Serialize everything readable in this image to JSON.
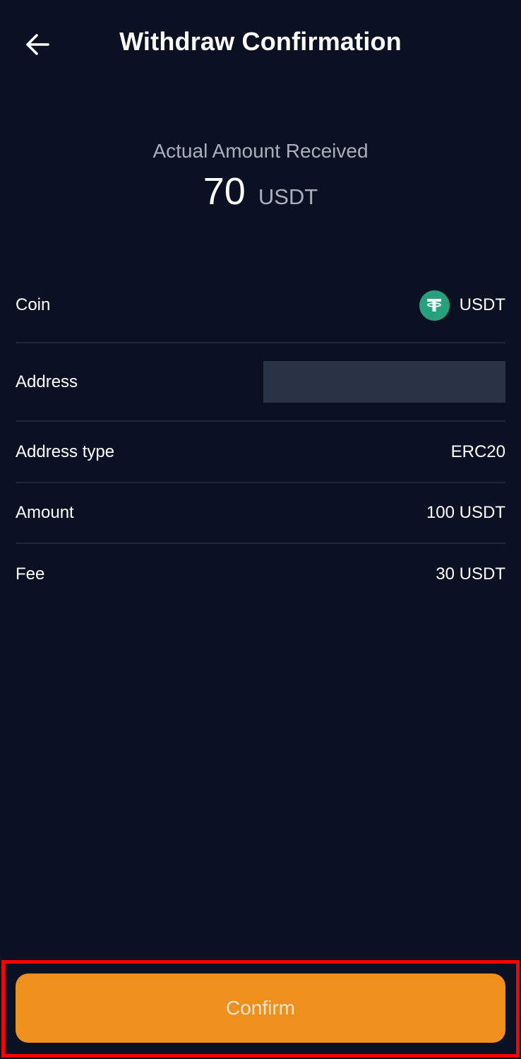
{
  "header": {
    "title": "Withdraw Confirmation",
    "back_icon": "arrow-left-icon"
  },
  "summary": {
    "label": "Actual Amount Received",
    "amount": "70",
    "unit": "USDT"
  },
  "details": {
    "coin": {
      "label": "Coin",
      "value": "USDT",
      "icon": "tether-icon",
      "icon_color": "#26a17b"
    },
    "address": {
      "label": "Address"
    },
    "address_type": {
      "label": "Address type",
      "value": "ERC20"
    },
    "amount": {
      "label": "Amount",
      "value": "100 USDT"
    },
    "fee": {
      "label": "Fee",
      "value": "30 USDT"
    }
  },
  "actions": {
    "confirm_label": "Confirm",
    "confirm_color": "#ef8f1c",
    "highlight_color": "#ff0000"
  },
  "theme": {
    "background": "#0a1122",
    "divider": "#1f2738",
    "muted_text": "#aab0bb"
  }
}
